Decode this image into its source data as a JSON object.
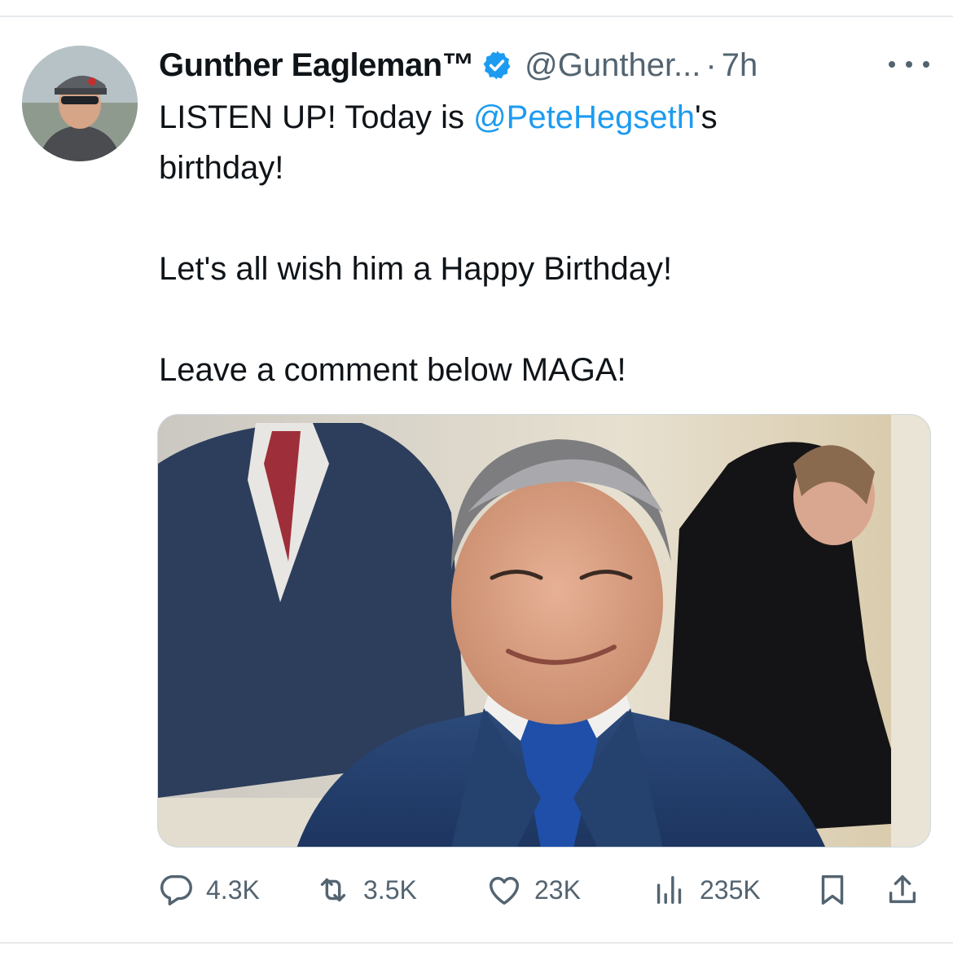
{
  "tweet": {
    "author": {
      "display_name": "Gunther Eagleman™",
      "handle": "@Gunther...",
      "verified": true,
      "avatar_icon": "profile-photo"
    },
    "separator": "·",
    "timestamp": "7h",
    "text": {
      "line1_prefix": "LISTEN UP! Today is ",
      "mention": "@PeteHegseth",
      "line1_suffix": "'s",
      "line2": "birthday!",
      "paragraph2": "Let's all wish him a Happy Birthday!",
      "paragraph3": "Leave a comment below MAGA!"
    },
    "media_icon": "photo-of-smiling-man-in-suit",
    "stats": {
      "replies": "4.3K",
      "reposts": "3.5K",
      "likes": "23K",
      "views": "235K"
    }
  },
  "colors": {
    "text": "#0f1419",
    "secondary": "#536471",
    "accent": "#1d9bf0",
    "divider": "#e6e9ec"
  },
  "icons": {
    "reply": "reply-icon",
    "repost": "repost-icon",
    "like": "heart-icon",
    "views": "views-icon",
    "bookmark": "bookmark-icon",
    "share": "share-icon",
    "more": "more-icon",
    "verified": "verified-badge-icon"
  }
}
